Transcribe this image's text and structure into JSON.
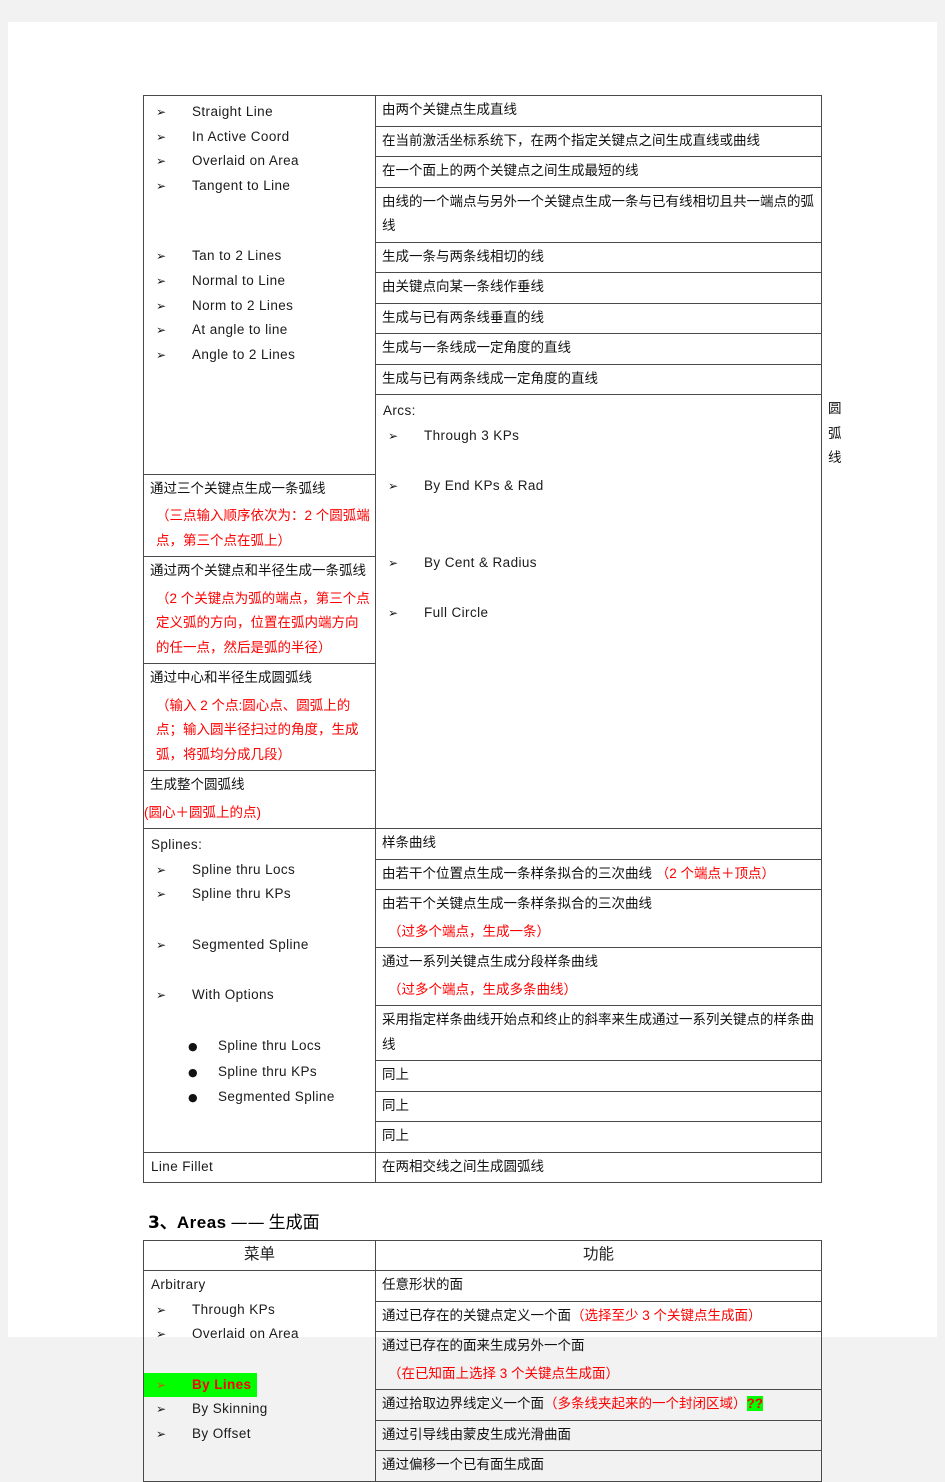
{
  "document": {
    "bullet_arrow": "➢",
    "bullet_dot": "●",
    "colors": {
      "annotation_red": "#FF0000",
      "highlight_green": "#00FF00",
      "text": "#111111",
      "table_border": "#4A4A4A",
      "page_background": "#FFFFFF"
    }
  },
  "lines_table": {
    "menu_items": [
      {
        "bullet": "arrow",
        "label": "Straight Line"
      },
      {
        "bullet": "arrow",
        "label": "In Active Coord"
      },
      {
        "bullet": "arrow",
        "label": "Overlaid on Area"
      },
      {
        "bullet": "arrow",
        "label": "Tangent to Line"
      },
      {
        "bullet": "arrow",
        "label": "Tan to 2 Lines"
      },
      {
        "bullet": "arrow",
        "label": "Normal to Line"
      },
      {
        "bullet": "arrow",
        "label": "Norm to 2 Lines"
      },
      {
        "bullet": "arrow",
        "label": "At angle to line"
      },
      {
        "bullet": "arrow",
        "label": "Angle to 2 Lines"
      }
    ],
    "functions": [
      {
        "text": "由两个关键点生成直线"
      },
      {
        "text": "在当前激活坐标系统下，在两个指定关键点之间生成直线或曲线"
      },
      {
        "text": "在一个面上的两个关键点之间生成最短的线"
      },
      {
        "text": "由线的一个端点与另外一个关键点生成一条与已有线相切且共一端点的弧线"
      },
      {
        "text": "生成一条与两条线相切的线"
      },
      {
        "text": "由关键点向某一条线作垂线"
      },
      {
        "text": "生成与已有两条线垂直的线"
      },
      {
        "text": "生成与一条线成一定角度的直线"
      },
      {
        "text": "生成与已有两条线成一定角度的直线"
      }
    ]
  },
  "arcs_table": {
    "group_label": "Arcs:",
    "group_function": "圆弧线",
    "menu_items": [
      {
        "bullet": "arrow",
        "label": "Through 3 KPs"
      },
      {
        "bullet": "arrow",
        "label": "By End KPs & Rad"
      },
      {
        "bullet": "arrow",
        "label": "By Cent & Radius"
      },
      {
        "bullet": "arrow",
        "label": "Full Circle"
      }
    ],
    "functions": [
      {
        "text": "通过三个关键点生成一条弧线",
        "note": "（三点输入顺序依次为：2 个圆弧端点，第三个点在弧上）"
      },
      {
        "text": "通过两个关键点和半径生成一条弧线",
        "note": "（2 个关键点为弧的端点，第三个点定义弧的方向，位置在弧内端方向的任一点，然后是弧的半径）"
      },
      {
        "text": "通过中心和半径生成圆弧线",
        "note": "（输入 2 个点:圆心点、圆弧上的点；输入圆半径扫过的角度，生成弧，将弧均分成几段）"
      },
      {
        "text": "生成整个圆弧线",
        "note": "(圆心＋圆弧上的点)"
      }
    ]
  },
  "splines_table": {
    "group_label": "Splines:",
    "group_function": "样条曲线",
    "menu_items": [
      {
        "bullet": "arrow",
        "label": "Spline thru Locs"
      },
      {
        "bullet": "arrow",
        "label": "Spline thru KPs"
      },
      {
        "bullet": "arrow",
        "label": "Segmented Spline"
      },
      {
        "bullet": "arrow",
        "label": "With Options"
      },
      {
        "bullet": "dot",
        "label": "Spline thru Locs"
      },
      {
        "bullet": "dot",
        "label": "Spline thru KPs"
      },
      {
        "bullet": "dot",
        "label": "Segmented Spline"
      }
    ],
    "functions": [
      {
        "text": "由若干个位置点生成一条样条拟合的三次曲线",
        "inline_note": "（2 个端点＋顶点）"
      },
      {
        "text": "由若干个关键点生成一条样条拟合的三次曲线",
        "note": "（过多个端点，生成一条）"
      },
      {
        "text": "通过一系列关键点生成分段样条曲线",
        "note": "（过多个端点，生成多条曲线）"
      },
      {
        "text": "采用指定样条曲线开始点和终止的斜率来生成通过一系列关键点的样条曲线"
      },
      {
        "text": "同上"
      },
      {
        "text": "同上"
      },
      {
        "text": "同上"
      }
    ]
  },
  "line_fillet_row": {
    "menu": "Line Fillet",
    "function": "在两相交线之间生成圆弧线"
  },
  "areas_section": {
    "heading": {
      "number": "3、",
      "english": "Areas",
      "dash": "——",
      "chinese": "生成面"
    },
    "headers": {
      "menu": "菜单",
      "function": "功能"
    },
    "menu_items": [
      {
        "bullet": "none",
        "label": "Arbitrary",
        "highlight": false
      },
      {
        "bullet": "arrow",
        "label": "Through KPs",
        "highlight": false
      },
      {
        "bullet": "arrow",
        "label": "Overlaid on Area",
        "highlight": false
      },
      {
        "bullet": "arrow",
        "label": "By Lines",
        "highlight": true
      },
      {
        "bullet": "arrow",
        "label": "By Skinning",
        "highlight": false
      },
      {
        "bullet": "arrow",
        "label": "By Offset",
        "highlight": false
      }
    ],
    "functions": [
      {
        "text": "任意形状的面"
      },
      {
        "text": "通过已存在的关键点定义一个面",
        "inline_note": "（选择至少 3 个关键点生成面）"
      },
      {
        "text": "通过已存在的面来生成另外一个面",
        "note": "（在已知面上选择 3 个关键点生成面）"
      },
      {
        "text": "通过拾取边界线定义一个面",
        "inline_note": "（多条线夹起来的一个封闭区域）",
        "question_marks": "??"
      },
      {
        "text": "通过引导线由蒙皮生成光滑曲面"
      },
      {
        "text": "通过偏移一个已有面生成面"
      }
    ]
  }
}
